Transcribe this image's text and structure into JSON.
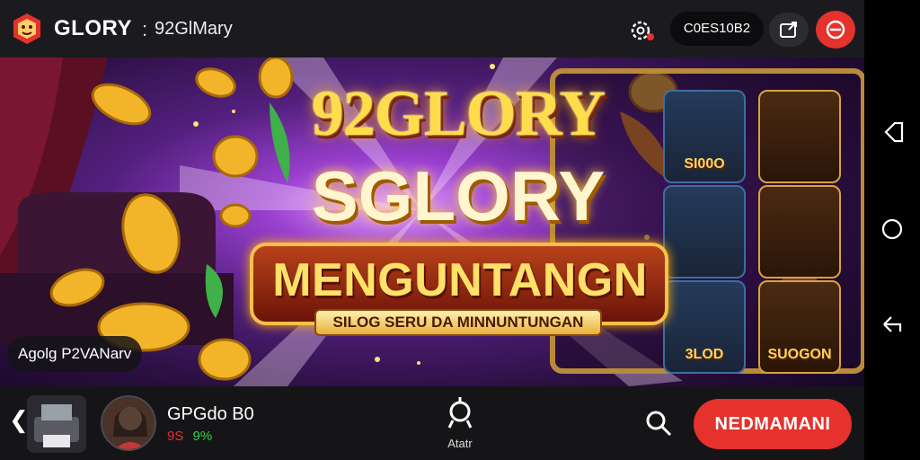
{
  "header": {
    "brand": "GLORY",
    "separator": ":",
    "subtitle": "92GlMary",
    "balance_pill": "C0ES10B2"
  },
  "banner": {
    "title_line1": "92GLORY",
    "title_line2": "SGLORY",
    "title_line3": "MENGUNTANGN",
    "tagline": "SILOG SERU DA MINNUNTUNGAN",
    "promo_badge": "Agolg P2VANarv",
    "slot_labels": [
      "SI00O",
      "3LOD",
      "SUOGON"
    ]
  },
  "bottom_bar": {
    "player_name": "GPGdo B0",
    "stat_red": "9S",
    "stat_green": "9%",
    "action_label": "Atatr",
    "cta_label": "NEDMAMANI"
  },
  "colors": {
    "accent_red": "#e5322d",
    "topbar_bg": "#1b1b1f",
    "bottombar_bg": "#151518",
    "stat_green": "#36d14b",
    "gold": "#ffd35a"
  },
  "icons": {
    "logo": "lion-logo-icon",
    "settings": "gear-icon",
    "share": "share-icon",
    "menu": "menu-icon",
    "back": "chevron-left-icon",
    "action": "target-icon",
    "search": "search-icon",
    "nav_back": "android-back-icon",
    "nav_home": "android-home-icon",
    "nav_recent": "android-recent-icon"
  }
}
